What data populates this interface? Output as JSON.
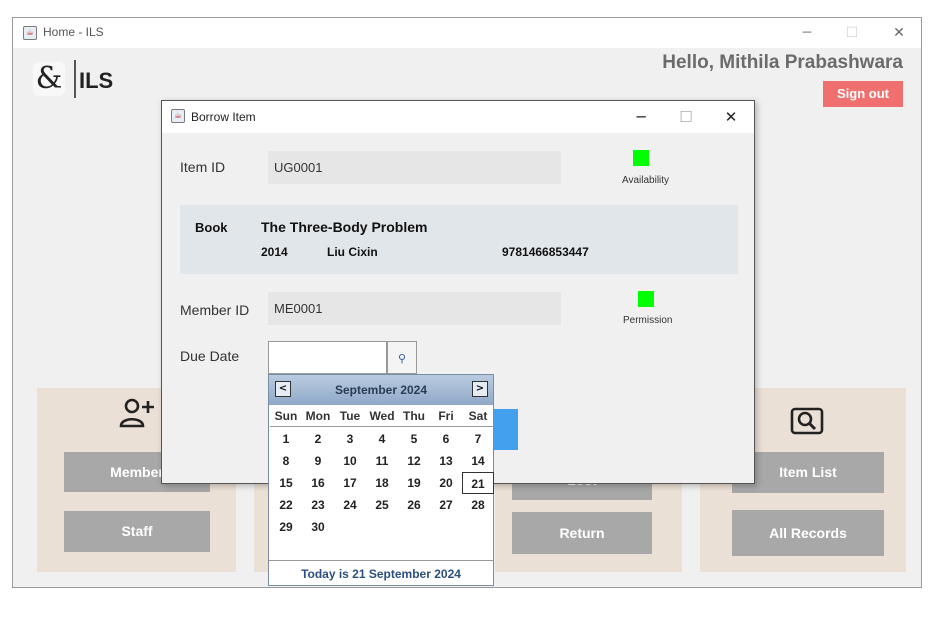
{
  "main_window": {
    "title": "Home - ILS",
    "minimize_glyph": "─",
    "maximize_glyph": "☐",
    "close_glyph": "✕"
  },
  "header": {
    "logo_glyph": "&",
    "logo_text": "ILS",
    "greeting": "Hello, Mithila Prabashwara",
    "sign_out": "Sign out",
    "sign_out_color": "#f07070"
  },
  "panels": {
    "members": {
      "icon": "add-person-icon",
      "icon_glyph": "👤+",
      "button1": "Member",
      "button2": "Staff"
    },
    "items": {
      "button_partial": "Lost",
      "button2": "Return"
    },
    "search": {
      "icon": "search-icon",
      "icon_glyph": "🔍",
      "button1": "Item List",
      "button2": "All Records"
    }
  },
  "dialog": {
    "title": "Borrow Item",
    "minimize_glyph": "─",
    "maximize_glyph": "☐",
    "close_glyph": "✕",
    "item_id_label": "Item ID",
    "item_id_value": "UG0001",
    "availability_label": "Availability",
    "availability_color": "#00ff00",
    "book": {
      "type": "Book",
      "title": "The Three-Body Problem",
      "year": "2014",
      "author": "Liu Cixin",
      "isbn": "9781466853447"
    },
    "member_id_label": "Member ID",
    "member_id_value": "ME0001",
    "permission_label": "Permission",
    "permission_color": "#00ff00",
    "due_date_label": "Due Date",
    "due_date_value": "",
    "date_picker_glyph": "⚲"
  },
  "calendar": {
    "month_label": "September 2024",
    "prev_glyph": "<",
    "next_glyph": ">",
    "weekdays": [
      "Sun",
      "Mon",
      "Tue",
      "Wed",
      "Thu",
      "Fri",
      "Sat"
    ],
    "first_weekday_index": 0,
    "days_in_month": 30,
    "today": 21,
    "footer": "Today is  21 September 2024"
  }
}
